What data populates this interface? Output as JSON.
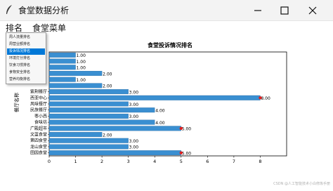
{
  "window": {
    "title": "食堂数据分析",
    "minimize_icon": "minimize-icon",
    "maximize_icon": "maximize-icon",
    "close_icon": "close-icon"
  },
  "menubar": {
    "items": [
      "排名",
      "食堂菜单"
    ]
  },
  "dropdown": {
    "items": [
      "周人流量排名",
      "周营业额排名",
      "投诉情况排名",
      "环境打分排名",
      "饮食习惯排名",
      "食物安全排名",
      "营养均衡排名"
    ],
    "active_index": 2
  },
  "chart_data": {
    "type": "bar",
    "orientation": "horizontal",
    "title": "食堂投诉情况排名",
    "ylabel": "餐厅名称",
    "xlabel": "",
    "xlim": [
      0,
      9
    ],
    "xticks": [
      0,
      1,
      2,
      3,
      4,
      5,
      6,
      7,
      8
    ],
    "categories": [
      "",
      "",
      "",
      "",
      "",
      "紫荆餐厅",
      "西亚中心",
      "风味餐厅",
      "民族餐厅",
      "枣小西",
      "食味坊",
      "广殿超市",
      "文蓝食堂",
      "第四食堂",
      "龙山食堂",
      "田园食堂"
    ],
    "values": [
      1,
      1,
      1,
      2,
      1,
      2,
      3,
      8,
      3,
      4,
      3,
      4,
      5,
      2,
      3,
      3,
      5
    ],
    "value_labels": [
      "1.00",
      "1.00",
      "1.00",
      "2.00",
      "1.00",
      "2.00",
      "3.00",
      "8.00",
      "3.00",
      "4.00",
      "3.00",
      "4.00",
      "5.00",
      "2.00",
      "3.00",
      "3.00",
      "5.00"
    ],
    "bar_color": "#3a8fd1",
    "highlight_marker_color": "#e02020",
    "grid": false
  },
  "watermark": "CSDN @人工智能技术小白修炼手册"
}
